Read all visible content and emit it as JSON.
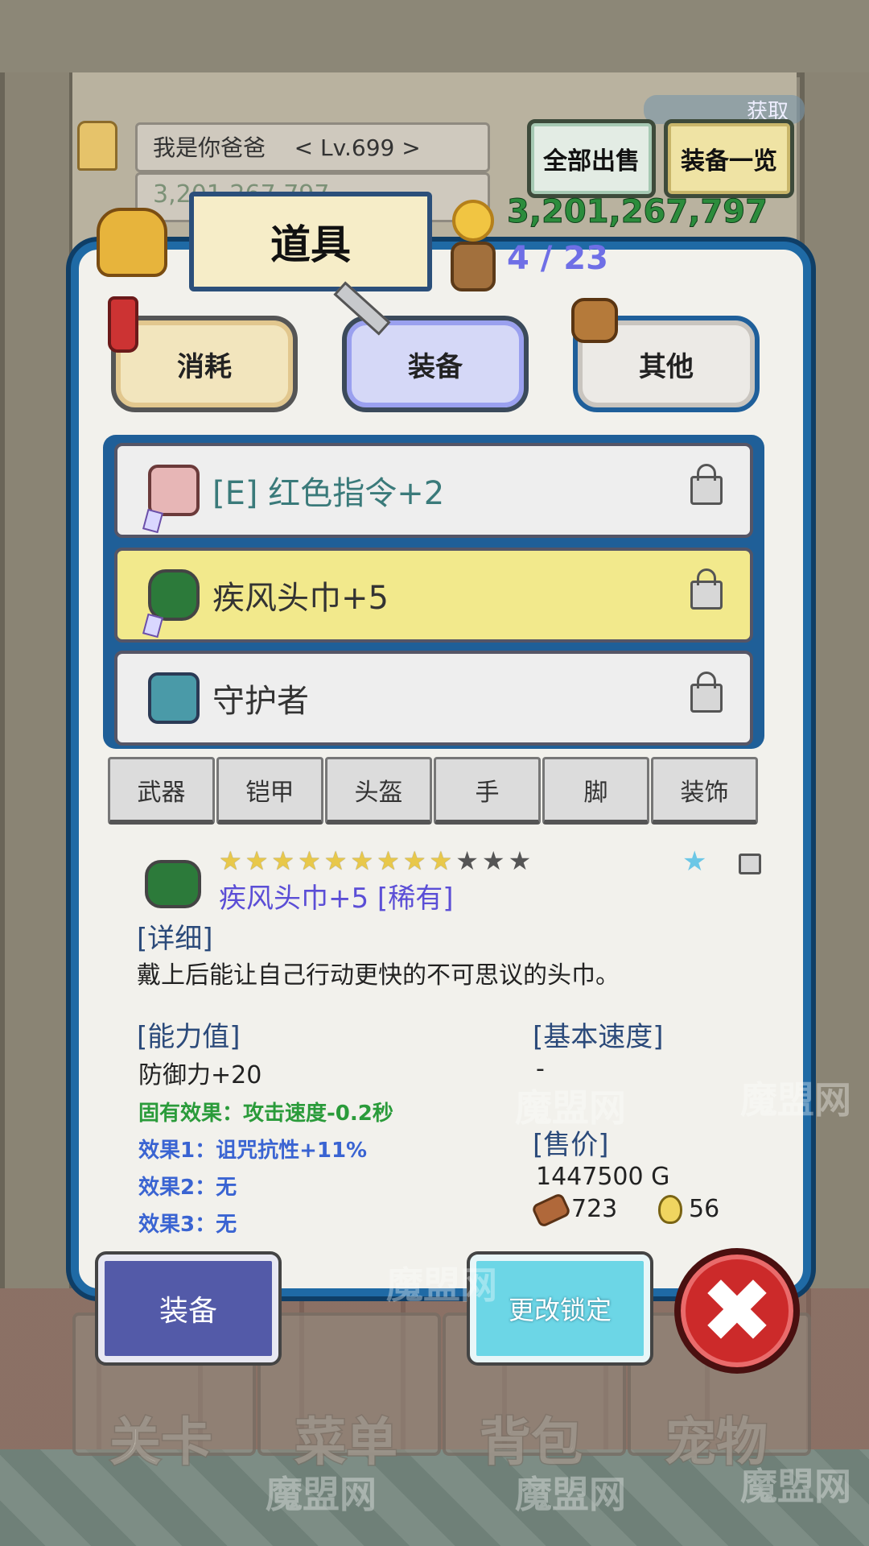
{
  "header": {
    "player_name": "我是你爸爸",
    "player_level": "< Lv.699 >",
    "gold_faded": "3,201,267,797",
    "sell_all_label": "全部出售",
    "equip_list_label": "装备一览",
    "capture_badge": "获取"
  },
  "panel": {
    "title": "道具",
    "gold_amount": "3,201,267,797",
    "slot_count": "4 / 23",
    "tabs": [
      "消耗",
      "装备",
      "其他"
    ],
    "selected_tab": "装备"
  },
  "items": [
    {
      "label": "[E] 红色指令+2",
      "color": "#3a7a7a",
      "icon": "red-helmet-icon"
    },
    {
      "label": "疾风头巾+5",
      "color": "#333333",
      "icon": "green-bandana-icon",
      "selected": true
    },
    {
      "label": "守护者",
      "color": "#333333",
      "icon": "guardian-helmet-icon"
    }
  ],
  "filters": [
    "武器",
    "铠甲",
    "头盔",
    "手",
    "脚",
    "装饰"
  ],
  "detail": {
    "stars_filled": 9,
    "stars_total": 12,
    "name": "疾风头巾+5 [稀有]",
    "detail_label": "[详细]",
    "description": "戴上后能让自己行动更快的不可思议的头巾。",
    "ability_label": "[能力值]",
    "defense": "防御力+20",
    "inherent_effect": "固有效果：攻击速度-0.2秒",
    "effect_1": "效果1：诅咒抗性+11%",
    "effect_2": "效果2：无",
    "effect_3": "效果3：无",
    "speed_label": "[基本速度]",
    "speed_value": "-",
    "price_label": "[售价]",
    "price_value": "1447500 G",
    "wood_value": "723",
    "oil_value": "56"
  },
  "actions": {
    "equip": "装备",
    "change_lock": "更改锁定",
    "close_icon": "✖"
  },
  "nav": [
    "关卡",
    "菜单",
    "背包",
    "宠物"
  ],
  "watermark": "魔盟网"
}
